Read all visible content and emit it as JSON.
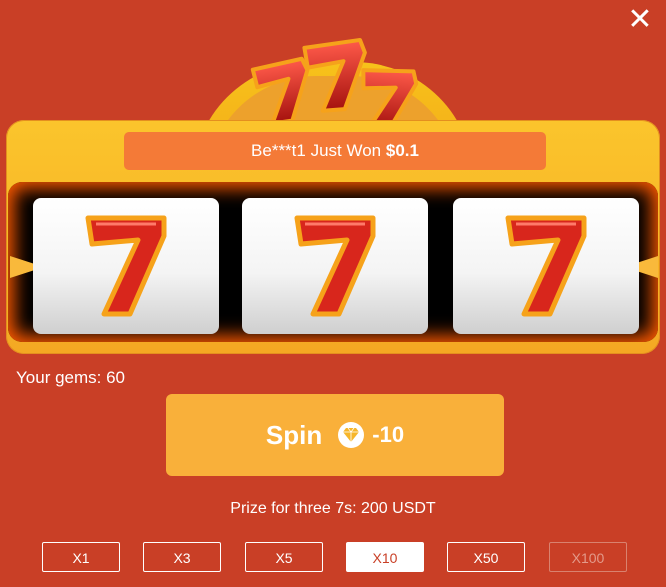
{
  "header": {
    "close_icon": "close-icon",
    "logo_text": "777"
  },
  "winner_banner": {
    "prefix": "Be***t1 Just Won ",
    "amount": "$0.1"
  },
  "reels": [
    {
      "symbol": "7"
    },
    {
      "symbol": "7"
    },
    {
      "symbol": "7"
    }
  ],
  "gems": {
    "label": "Your gems: 60"
  },
  "spin": {
    "label": "Spin",
    "icon": "gem-icon",
    "cost": "-10"
  },
  "prize": {
    "text": "Prize for three 7s: 200 USDT"
  },
  "multipliers": [
    {
      "label": "X1",
      "state": "normal"
    },
    {
      "label": "X3",
      "state": "normal"
    },
    {
      "label": "X5",
      "state": "normal"
    },
    {
      "label": "X10",
      "state": "selected"
    },
    {
      "label": "X50",
      "state": "normal"
    },
    {
      "label": "X100",
      "state": "disabled"
    }
  ],
  "colors": {
    "background": "#c93f26",
    "machine": "#fbc52c",
    "banner": "#f47a37",
    "spin_button": "#f9b03a",
    "seven_red": "#d8261c",
    "seven_outline": "#f6a21a"
  }
}
